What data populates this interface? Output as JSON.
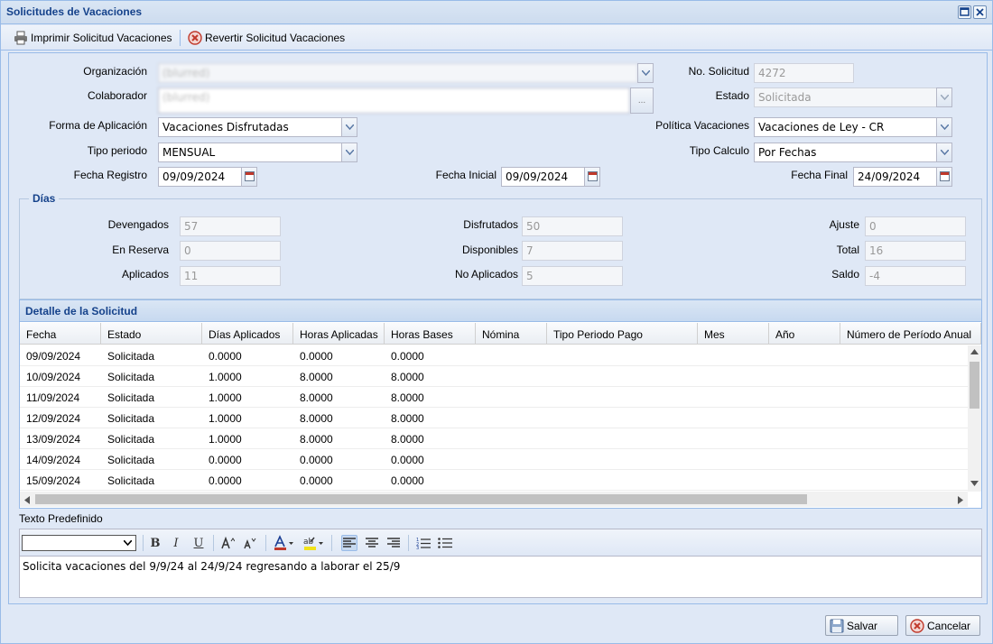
{
  "window": {
    "title": "Solicitudes de Vacaciones"
  },
  "toolbar": {
    "print_label": "Imprimir Solicitud Vacaciones",
    "revert_label": "Revertir Solicitud Vacaciones"
  },
  "form": {
    "organizacion_label": "Organización",
    "organizacion_value": "(blurred)",
    "colaborador_label": "Colaborador",
    "colaborador_value": "(blurred)",
    "no_solicitud_label": "No. Solicitud",
    "no_solicitud_value": "4272",
    "estado_label": "Estado",
    "estado_value": "Solicitada",
    "forma_label": "Forma de Aplicación",
    "forma_value": "Vacaciones Disfrutadas",
    "politica_label": "Política Vacaciones",
    "politica_value": "Vacaciones de Ley - CR",
    "tipo_periodo_label": "Tipo periodo",
    "tipo_periodo_value": "MENSUAL",
    "tipo_calculo_label": "Tipo Calculo",
    "tipo_calculo_value": "Por Fechas",
    "fecha_registro_label": "Fecha Registro",
    "fecha_registro_value": "09/09/2024",
    "fecha_inicial_label": "Fecha Inicial",
    "fecha_inicial_value": "09/09/2024",
    "fecha_final_label": "Fecha Final",
    "fecha_final_value": "24/09/2024",
    "more_button": "..."
  },
  "dias": {
    "legend": "Días",
    "devengados_label": "Devengados",
    "devengados_value": "57",
    "en_reserva_label": "En Reserva",
    "en_reserva_value": "0",
    "aplicados_label": "Aplicados",
    "aplicados_value": "11",
    "disfrutados_label": "Disfrutados",
    "disfrutados_value": "50",
    "disponibles_label": "Disponibles",
    "disponibles_value": "7",
    "no_aplicados_label": "No Aplicados",
    "no_aplicados_value": "5",
    "ajuste_label": "Ajuste",
    "ajuste_value": "0",
    "total_label": "Total",
    "total_value": "16",
    "saldo_label": "Saldo",
    "saldo_value": "-4"
  },
  "detalle": {
    "title": "Detalle de la Solicitud",
    "columns": [
      "Fecha",
      "Estado",
      "Días Aplicados",
      "Horas Aplicadas",
      "Horas Bases",
      "Nómina",
      "Tipo Periodo Pago",
      "Mes",
      "Año",
      "Número de Período Anual"
    ],
    "rows": [
      [
        "09/09/2024",
        "Solicitada",
        "0.0000",
        "0.0000",
        "0.0000"
      ],
      [
        "10/09/2024",
        "Solicitada",
        "1.0000",
        "8.0000",
        "8.0000"
      ],
      [
        "11/09/2024",
        "Solicitada",
        "1.0000",
        "8.0000",
        "8.0000"
      ],
      [
        "12/09/2024",
        "Solicitada",
        "1.0000",
        "8.0000",
        "8.0000"
      ],
      [
        "13/09/2024",
        "Solicitada",
        "1.0000",
        "8.0000",
        "8.0000"
      ],
      [
        "14/09/2024",
        "Solicitada",
        "0.0000",
        "0.0000",
        "0.0000"
      ],
      [
        "15/09/2024",
        "Solicitada",
        "0.0000",
        "0.0000",
        "0.0000"
      ]
    ]
  },
  "texto": {
    "label": "Texto Predefinido",
    "content": "Solicita vacaciones del 9/9/24 al 24/9/24 regresando a laborar el 25/9",
    "bold": "B",
    "italic": "I",
    "underline": "U"
  },
  "footer": {
    "save_label": "Salvar",
    "cancel_label": "Cancelar"
  },
  "colors": {
    "title": "#15428b",
    "panel": "#dfe8f6",
    "border": "#99bbe8"
  }
}
